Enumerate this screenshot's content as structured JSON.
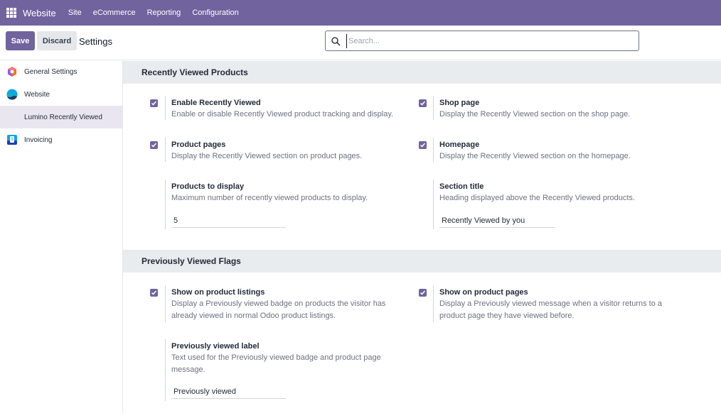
{
  "navbar": {
    "brand": "Website",
    "menu": [
      "Site",
      "eCommerce",
      "Reporting",
      "Configuration"
    ]
  },
  "control_panel": {
    "save_label": "Save",
    "discard_label": "Discard",
    "title": "Settings",
    "search_placeholder": "Search..."
  },
  "sidebar": {
    "items": [
      {
        "label": "General Settings",
        "icon": "general-settings-icon"
      },
      {
        "label": "Website",
        "icon": "website-app-icon"
      },
      {
        "label": "Lumino Recently Viewed",
        "icon": "",
        "active": true
      },
      {
        "label": "Invoicing",
        "icon": "invoicing-app-icon"
      }
    ]
  },
  "sections": {
    "recently": {
      "title": "Recently Viewed Products",
      "enable": {
        "title": "Enable Recently Viewed",
        "desc": "Enable or disable Recently Viewed product tracking and display.",
        "checked": true
      },
      "shop": {
        "title": "Shop page",
        "desc": "Display the Recently Viewed section on the shop page.",
        "checked": true
      },
      "product_pages": {
        "title": "Product pages",
        "desc": "Display the Recently Viewed section on product pages.",
        "checked": true
      },
      "homepage": {
        "title": "Homepage",
        "desc": "Display the Recently Viewed section on the homepage.",
        "checked": true
      },
      "count": {
        "title": "Products to display",
        "desc": "Maximum number of recently viewed products to display.",
        "value": "5"
      },
      "section_title": {
        "title": "Section title",
        "desc": "Heading displayed above the Recently Viewed products.",
        "value": "Recently Viewed by you"
      }
    },
    "flags": {
      "title": "Previously Viewed Flags",
      "listings": {
        "title": "Show on product listings",
        "desc1": "Display a Previously viewed badge on products the visitor has",
        "desc2": "already viewed in normal Odoo product listings.",
        "checked": true
      },
      "pages": {
        "title": "Show on product pages",
        "desc1": "Display a Previously viewed message when a visitor returns to a",
        "desc2": "product page they have viewed before.",
        "checked": true
      },
      "label": {
        "title": "Previously viewed label",
        "desc1": "Text used for the Previously viewed badge and product page",
        "desc2": "message.",
        "value": "Previously viewed"
      }
    }
  },
  "colors": {
    "accent": "#71639e",
    "section_bg": "#e9ecef",
    "active_item_bg": "#e9e6f0"
  }
}
